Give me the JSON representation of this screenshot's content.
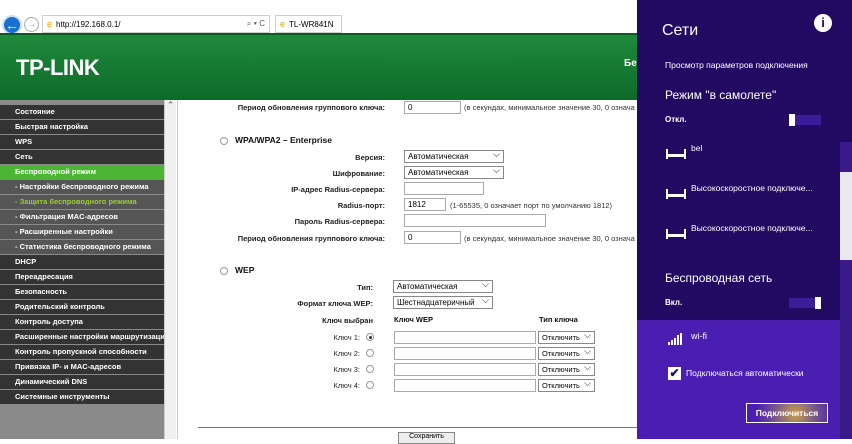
{
  "browser": {
    "url": "http://192.168.0.1/",
    "tab_title": "TL-WR841N",
    "tab_close": "×",
    "back": "←",
    "forward": "→",
    "search": "⌕ ▾ C"
  },
  "header": {
    "logo": "TP-LINK",
    "right_text": "Бе"
  },
  "sidebar": {
    "items": [
      {
        "label": "Состояние",
        "type": "main"
      },
      {
        "label": "Быстрая настройка",
        "type": "main"
      },
      {
        "label": "WPS",
        "type": "main"
      },
      {
        "label": "Сеть",
        "type": "main"
      },
      {
        "label": "Беспроводной режим",
        "type": "active"
      },
      {
        "label": "- Настройки беспроводного режима",
        "type": "sub"
      },
      {
        "label": "- Защита беспроводного режима",
        "type": "cur"
      },
      {
        "label": "- Фильтрация MAC-адресов",
        "type": "sub"
      },
      {
        "label": "- Расширенные настройки",
        "type": "sub"
      },
      {
        "label": "- Статистика беспроводного режима",
        "type": "sub"
      },
      {
        "label": "DHCP",
        "type": "main"
      },
      {
        "label": "Переадресация",
        "type": "main"
      },
      {
        "label": "Безопасность",
        "type": "main"
      },
      {
        "label": "Родительский контроль",
        "type": "main"
      },
      {
        "label": "Контроль доступа",
        "type": "main"
      },
      {
        "label": "Расширенные настройки маршрутизации",
        "type": "main"
      },
      {
        "label": "Контроль пропускной способности",
        "type": "main"
      },
      {
        "label": "Привязка IP- и MAC-адресов",
        "type": "main"
      },
      {
        "label": "Динамический DNS",
        "type": "main"
      },
      {
        "label": "Системные инструменты",
        "type": "main"
      }
    ]
  },
  "main": {
    "top_period": {
      "label": "Период обновления группового ключа:",
      "value": "0",
      "note": "(в секундах, минимальное значение 30, 0 означа"
    },
    "enterprise": {
      "title": "WPA/WPA2 – Enterprise",
      "version_label": "Версия:",
      "version": "Автоматическая",
      "encryption_label": "Шифрование:",
      "encryption": "Автоматическая",
      "radius_ip_label": "IP-адрес Radius-сервера:",
      "radius_ip": "",
      "radius_port_label": "Radius-порт:",
      "radius_port": "1812",
      "radius_port_note": "(1-65535, 0 означает порт по умолчанию 1812)",
      "radius_pass_label": "Пароль Radius-сервера:",
      "radius_pass": "",
      "period_label": "Период обновления группового ключа:",
      "period": "0",
      "period_note": "(в секундах, минимальное значение 30, 0 означа"
    },
    "wep": {
      "title": "WEP",
      "type_label": "Тип:",
      "type": "Автоматическая",
      "format_label": "Формат ключа WEP:",
      "format": "Шестнадцатеричный",
      "col_selected": "Ключ выбран",
      "col_key": "Ключ WEP",
      "col_type": "Тип ключа",
      "keys": [
        {
          "label": "Ключ 1:",
          "selected": true,
          "value": "",
          "type": "Отключить"
        },
        {
          "label": "Ключ 2:",
          "selected": false,
          "value": "",
          "type": "Отключить"
        },
        {
          "label": "Ключ 3:",
          "selected": false,
          "value": "",
          "type": "Отключить"
        },
        {
          "label": "Ключ 4:",
          "selected": false,
          "value": "",
          "type": "Отключить"
        }
      ]
    },
    "save_label": "Сохранить"
  },
  "networks": {
    "title": "Сети",
    "info": "i",
    "view_settings": "Просмотр параметров подключения",
    "airplane_title": "Режим \"в самолете\"",
    "airplane_state": "Откл.",
    "connections": [
      "bel",
      "Высокоскоростное подключе...",
      "Высокоскоростное подключе..."
    ],
    "wireless_title": "Беспроводная сеть",
    "wireless_state": "Вкл.",
    "wifi_name": "wi-fi",
    "auto_connect": "Подключаться автоматически",
    "connect_button": "Подключиться"
  }
}
